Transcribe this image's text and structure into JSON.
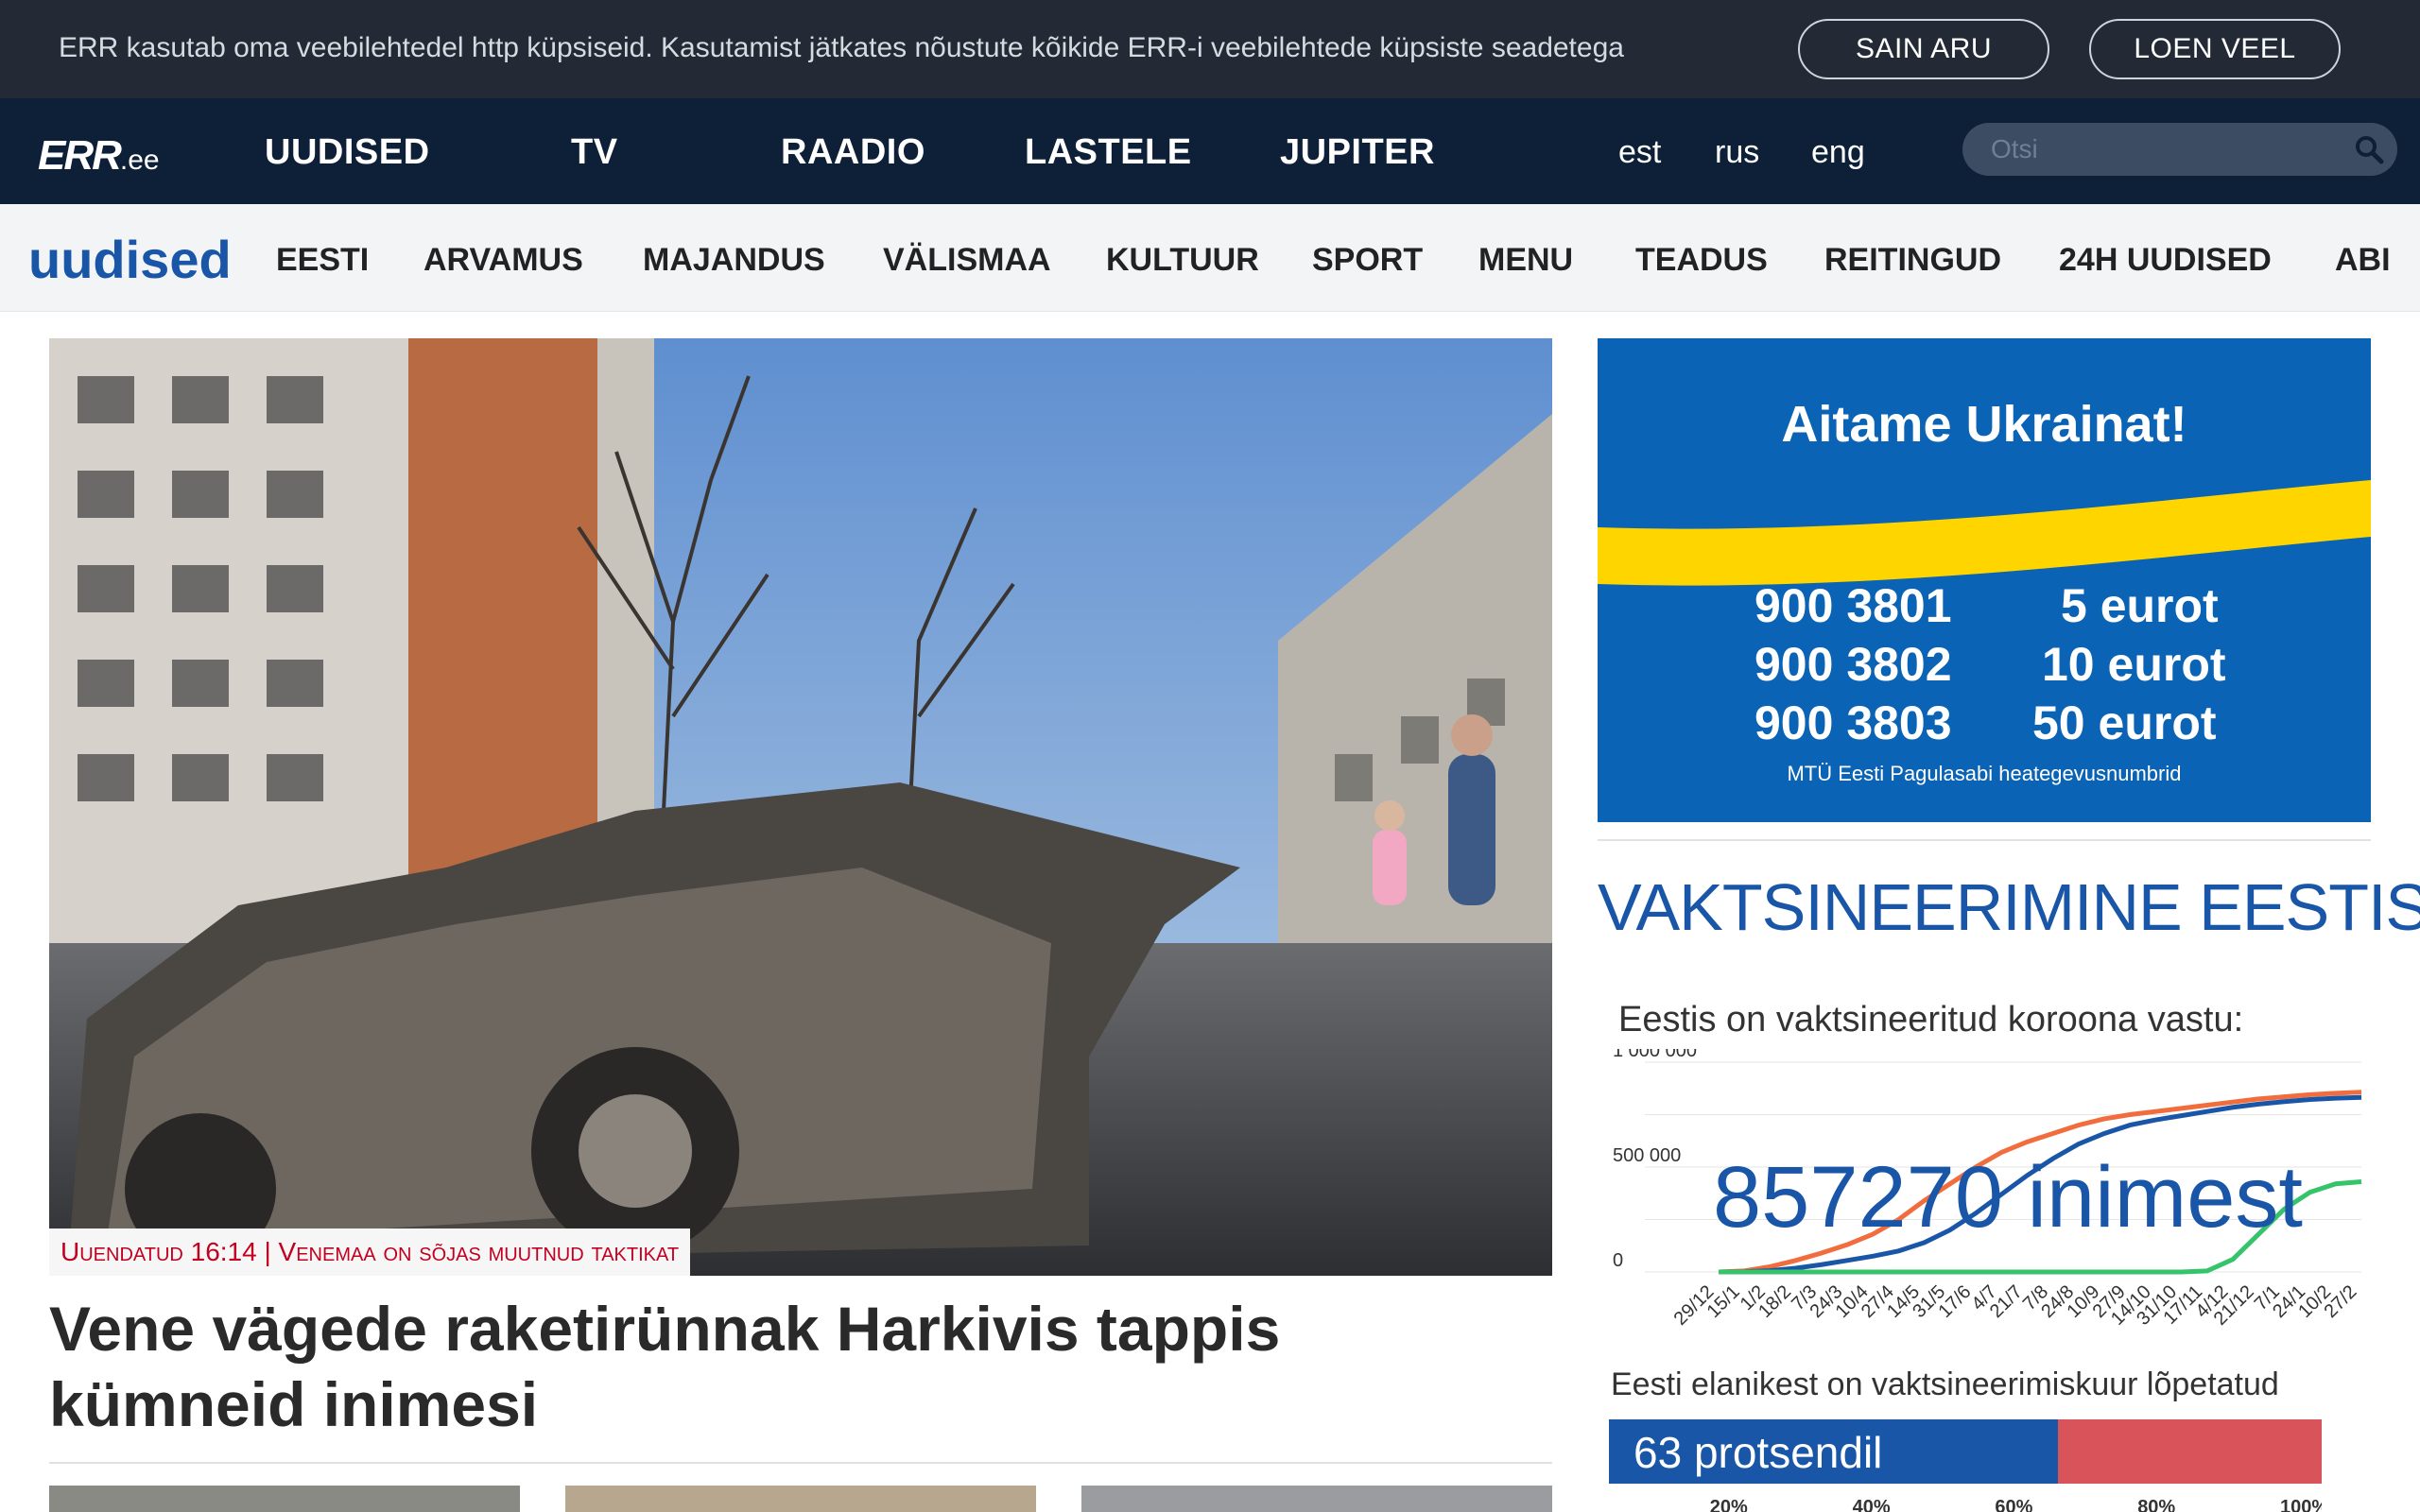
{
  "cookie": {
    "text": "ERR kasutab oma veebilehtedel http küpsiseid. Kasutamist jätkates nõustute kõikide ERR-i veebilehtede küpsiste seadetega",
    "accept_label": "SAIN ARU",
    "more_label": "LOEN VEEL"
  },
  "header": {
    "logo_main": "ERR",
    "logo_suffix": ".ee",
    "nav": [
      "UUDISED",
      "TV",
      "RAADIO",
      "LASTELE",
      "JUPITER"
    ],
    "langs": [
      "est",
      "rus",
      "eng"
    ],
    "search_placeholder": "Otsi"
  },
  "section_nav": {
    "brand": "uudised",
    "items": [
      "EESTI",
      "ARVAMUS",
      "MAJANDUS",
      "VÄLISMAA",
      "KULTUUR",
      "SPORT",
      "MENU",
      "TEADUS",
      "REITINGUD",
      "24H UUDISED",
      "ABI"
    ]
  },
  "hero": {
    "tag": "Uuendatud 16:14 | Venemaa on sõjas muutnud taktikat",
    "title": "Vene vägede raketirünnak Harkivis tappis kümneid inimesi"
  },
  "ukraine_ad": {
    "title": "Aitame Ukrainat!",
    "rows": [
      {
        "number": "900 3801",
        "amount": "5 eurot"
      },
      {
        "number": "900 3802",
        "amount": "10 eurot"
      },
      {
        "number": "900 3803",
        "amount": "50 eurot"
      }
    ],
    "footer": "MTÜ Eesti Pagulasabi heategevusnumbrid"
  },
  "vaccination": {
    "heading": "VAKTSINEERIMINE EESTIS",
    "subtitle": "Eestis on vaktsineeritud koroona vastu:",
    "big_number": "857270 inimest",
    "completed_text": "Eesti elanikest on vaktsineerimiskuur lõpetatud",
    "completed_label": "63 protsendil",
    "completed_percent": 63,
    "scale_ticks": [
      "20%",
      "40%",
      "60%",
      "80%",
      "100%"
    ],
    "colors": {
      "blue": "#1a56a8",
      "orange": "#f26d3d",
      "green": "#35c46a",
      "red": "#d9545a"
    }
  },
  "chart_data": {
    "type": "line",
    "title": "Eestis on vaktsineeritud koroona vastu:",
    "x": [
      "29/12",
      "15/1",
      "1/2",
      "18/2",
      "7/3",
      "24/3",
      "10/4",
      "27/4",
      "14/5",
      "31/5",
      "17/6",
      "4/7",
      "21/7",
      "7/8",
      "24/8",
      "10/9",
      "27/9",
      "14/10",
      "31/10",
      "17/11",
      "4/12",
      "21/12",
      "7/1",
      "24/1",
      "10/2",
      "27/2"
    ],
    "ylim": [
      0,
      1000000
    ],
    "yticks": [
      "1 000 000",
      "500 000",
      "0"
    ],
    "series": [
      {
        "values": [
          0,
          5000,
          25000,
          55000,
          90000,
          130000,
          180000,
          250000,
          340000,
          420000,
          500000,
          570000,
          620000,
          660000,
          700000,
          730000,
          750000,
          765000,
          780000,
          795000,
          810000,
          825000,
          835000,
          845000,
          852000,
          857270
        ]
      },
      {
        "values": [
          0,
          1000,
          6000,
          18000,
          35000,
          55000,
          75000,
          100000,
          140000,
          200000,
          280000,
          370000,
          460000,
          540000,
          610000,
          660000,
          700000,
          725000,
          745000,
          765000,
          785000,
          800000,
          812000,
          822000,
          828000,
          832000
        ]
      },
      {
        "values": [
          0,
          0,
          0,
          0,
          0,
          0,
          0,
          0,
          0,
          0,
          0,
          0,
          0,
          0,
          0,
          0,
          0,
          0,
          0,
          5000,
          60000,
          180000,
          300000,
          380000,
          420000,
          430000
        ]
      }
    ]
  }
}
